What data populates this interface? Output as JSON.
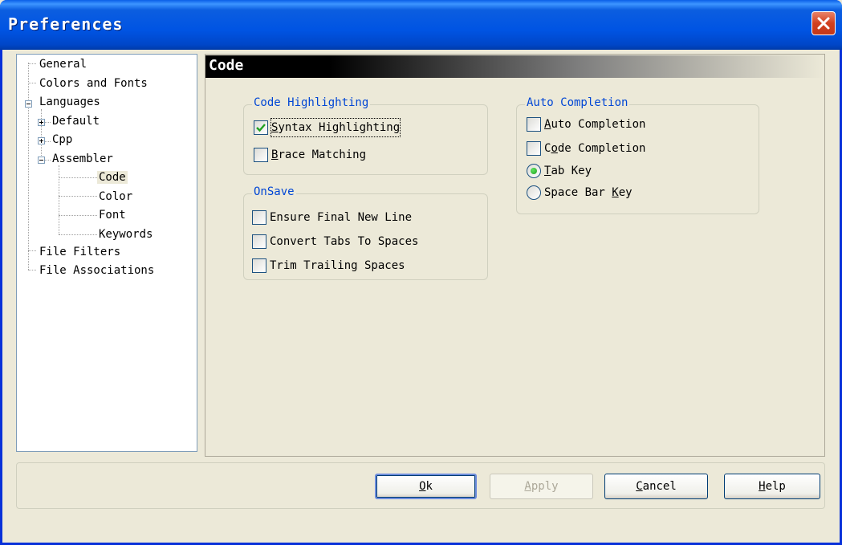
{
  "window": {
    "title": "Preferences",
    "close_icon": "close-icon"
  },
  "tree": {
    "items": [
      {
        "label": "General"
      },
      {
        "label": "Colors and Fonts"
      },
      {
        "label": "Languages"
      },
      {
        "label": "Default"
      },
      {
        "label": "Cpp"
      },
      {
        "label": "Assembler"
      },
      {
        "label": "Code",
        "selected": true
      },
      {
        "label": "Color"
      },
      {
        "label": "Font"
      },
      {
        "label": "Keywords"
      },
      {
        "label": "File Filters"
      },
      {
        "label": "File Associations"
      }
    ]
  },
  "panel": {
    "header": "Code"
  },
  "code_highlighting": {
    "title": "Code Highlighting",
    "syntax_highlighting": {
      "label_pre": "",
      "label_u": "S",
      "label_post": "yntax Highlighting",
      "checked": true
    },
    "brace_matching": {
      "label_pre": "",
      "label_u": "B",
      "label_post": "race Matching",
      "checked": false
    }
  },
  "on_save": {
    "title": "OnSave",
    "ensure_final_new_line": {
      "label": "Ensure Final New Line",
      "checked": false
    },
    "convert_tabs": {
      "label": "Convert Tabs To Spaces",
      "checked": false
    },
    "trim_trailing": {
      "label": "Trim Trailing Spaces",
      "checked": false
    }
  },
  "auto_completion": {
    "title": "Auto Completion",
    "auto_completion": {
      "label_pre": "",
      "label_u": "A",
      "label_post": "uto Completion",
      "checked": false
    },
    "code_completion": {
      "label_pre": "C",
      "label_u": "o",
      "label_post": "de Completion",
      "checked": false
    },
    "tab_key": {
      "label_pre": "",
      "label_u": "T",
      "label_post": "ab Key",
      "selected": true
    },
    "space_bar_key": {
      "label_pre": "Space Bar ",
      "label_u": "K",
      "label_post": "ey",
      "selected": false
    }
  },
  "buttons": {
    "ok": {
      "u": "O",
      "rest": "k"
    },
    "apply": {
      "u": "A",
      "rest": "pply",
      "disabled": true
    },
    "cancel": {
      "u": "C",
      "rest": "ancel"
    },
    "help": {
      "u": "H",
      "rest": "elp"
    }
  },
  "colors": {
    "title_bar": "#0054e3",
    "group_title": "#0046d5",
    "window_bg": "#ece9d8"
  }
}
